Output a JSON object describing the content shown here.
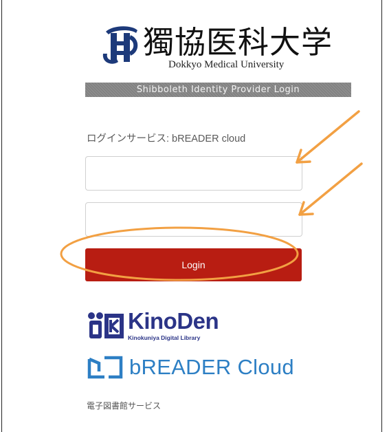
{
  "logo": {
    "kanji": "獨協医科大学",
    "english": "Dokkyo Medical University"
  },
  "idp_banner": "Shibboleth Identity Provider Login",
  "service_line": "ログインサービス: bREADER cloud",
  "form": {
    "username_value": "",
    "password_value": "",
    "login_label": "Login"
  },
  "partners": {
    "kinoden_name": "KinoDen",
    "kinoden_sub": "Kinokuniya Digital Library",
    "breader_name": "bREADER Cloud",
    "ebook_service": "電子図書館サービス"
  },
  "colors": {
    "accent_red": "#b81d12",
    "annotation_orange": "#f2a043",
    "kinoden_navy": "#2b3487",
    "breader_blue": "#2d7fc4"
  },
  "icons": [
    "dokkyo-emblem-icon",
    "kinoden-logo-icon",
    "book-logo-icon",
    "arrow-annotation-icon",
    "ellipse-annotation-icon"
  ]
}
